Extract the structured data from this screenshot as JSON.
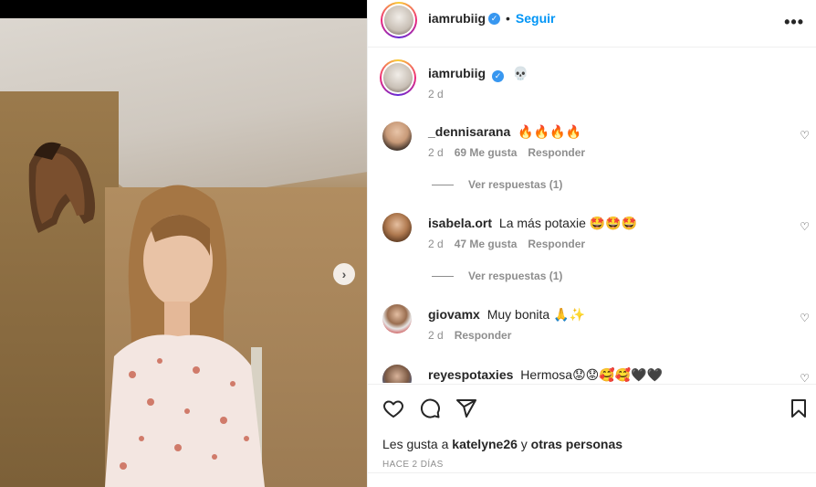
{
  "post": {
    "carousel_next_icon": "chevron-right-icon",
    "carousel_dots": 2,
    "carousel_active_index": 0
  },
  "header": {
    "username": "iamrubiig",
    "separator": "•",
    "follow_label": "Seguir",
    "more_icon": "•••"
  },
  "caption": {
    "username": "iamrubiig",
    "text": "💀",
    "time": "2 d"
  },
  "comments": [
    {
      "username": "_dennisarana",
      "text": "🔥🔥🔥🔥",
      "time": "2 d",
      "likes": "69 Me gusta",
      "reply_label": "Responder",
      "view_replies": "Ver respuestas (1)"
    },
    {
      "username": "isabela.ort",
      "text": "La más potaxie 🤩🤩🤩",
      "time": "2 d",
      "likes": "47 Me gusta",
      "reply_label": "Responder",
      "view_replies": "Ver respuestas (1)"
    },
    {
      "username": "giovamx",
      "text": "Muy bonita 🙏✨",
      "time": "2 d",
      "reply_label": "Responder"
    },
    {
      "username": "reyespotaxies",
      "text": "Hermosa😟😟🥰🥰🖤🖤"
    }
  ],
  "likes_line": {
    "prefix": "Les gusta a",
    "user": "katelyne26",
    "and": "y",
    "others": "otras personas"
  },
  "timestamp": "HACE 2 DÍAS",
  "colors": {
    "accent": "#0095f6",
    "verified": "#3897f0",
    "muted": "#8e8e8e",
    "text": "#262626",
    "border": "#efefef"
  }
}
